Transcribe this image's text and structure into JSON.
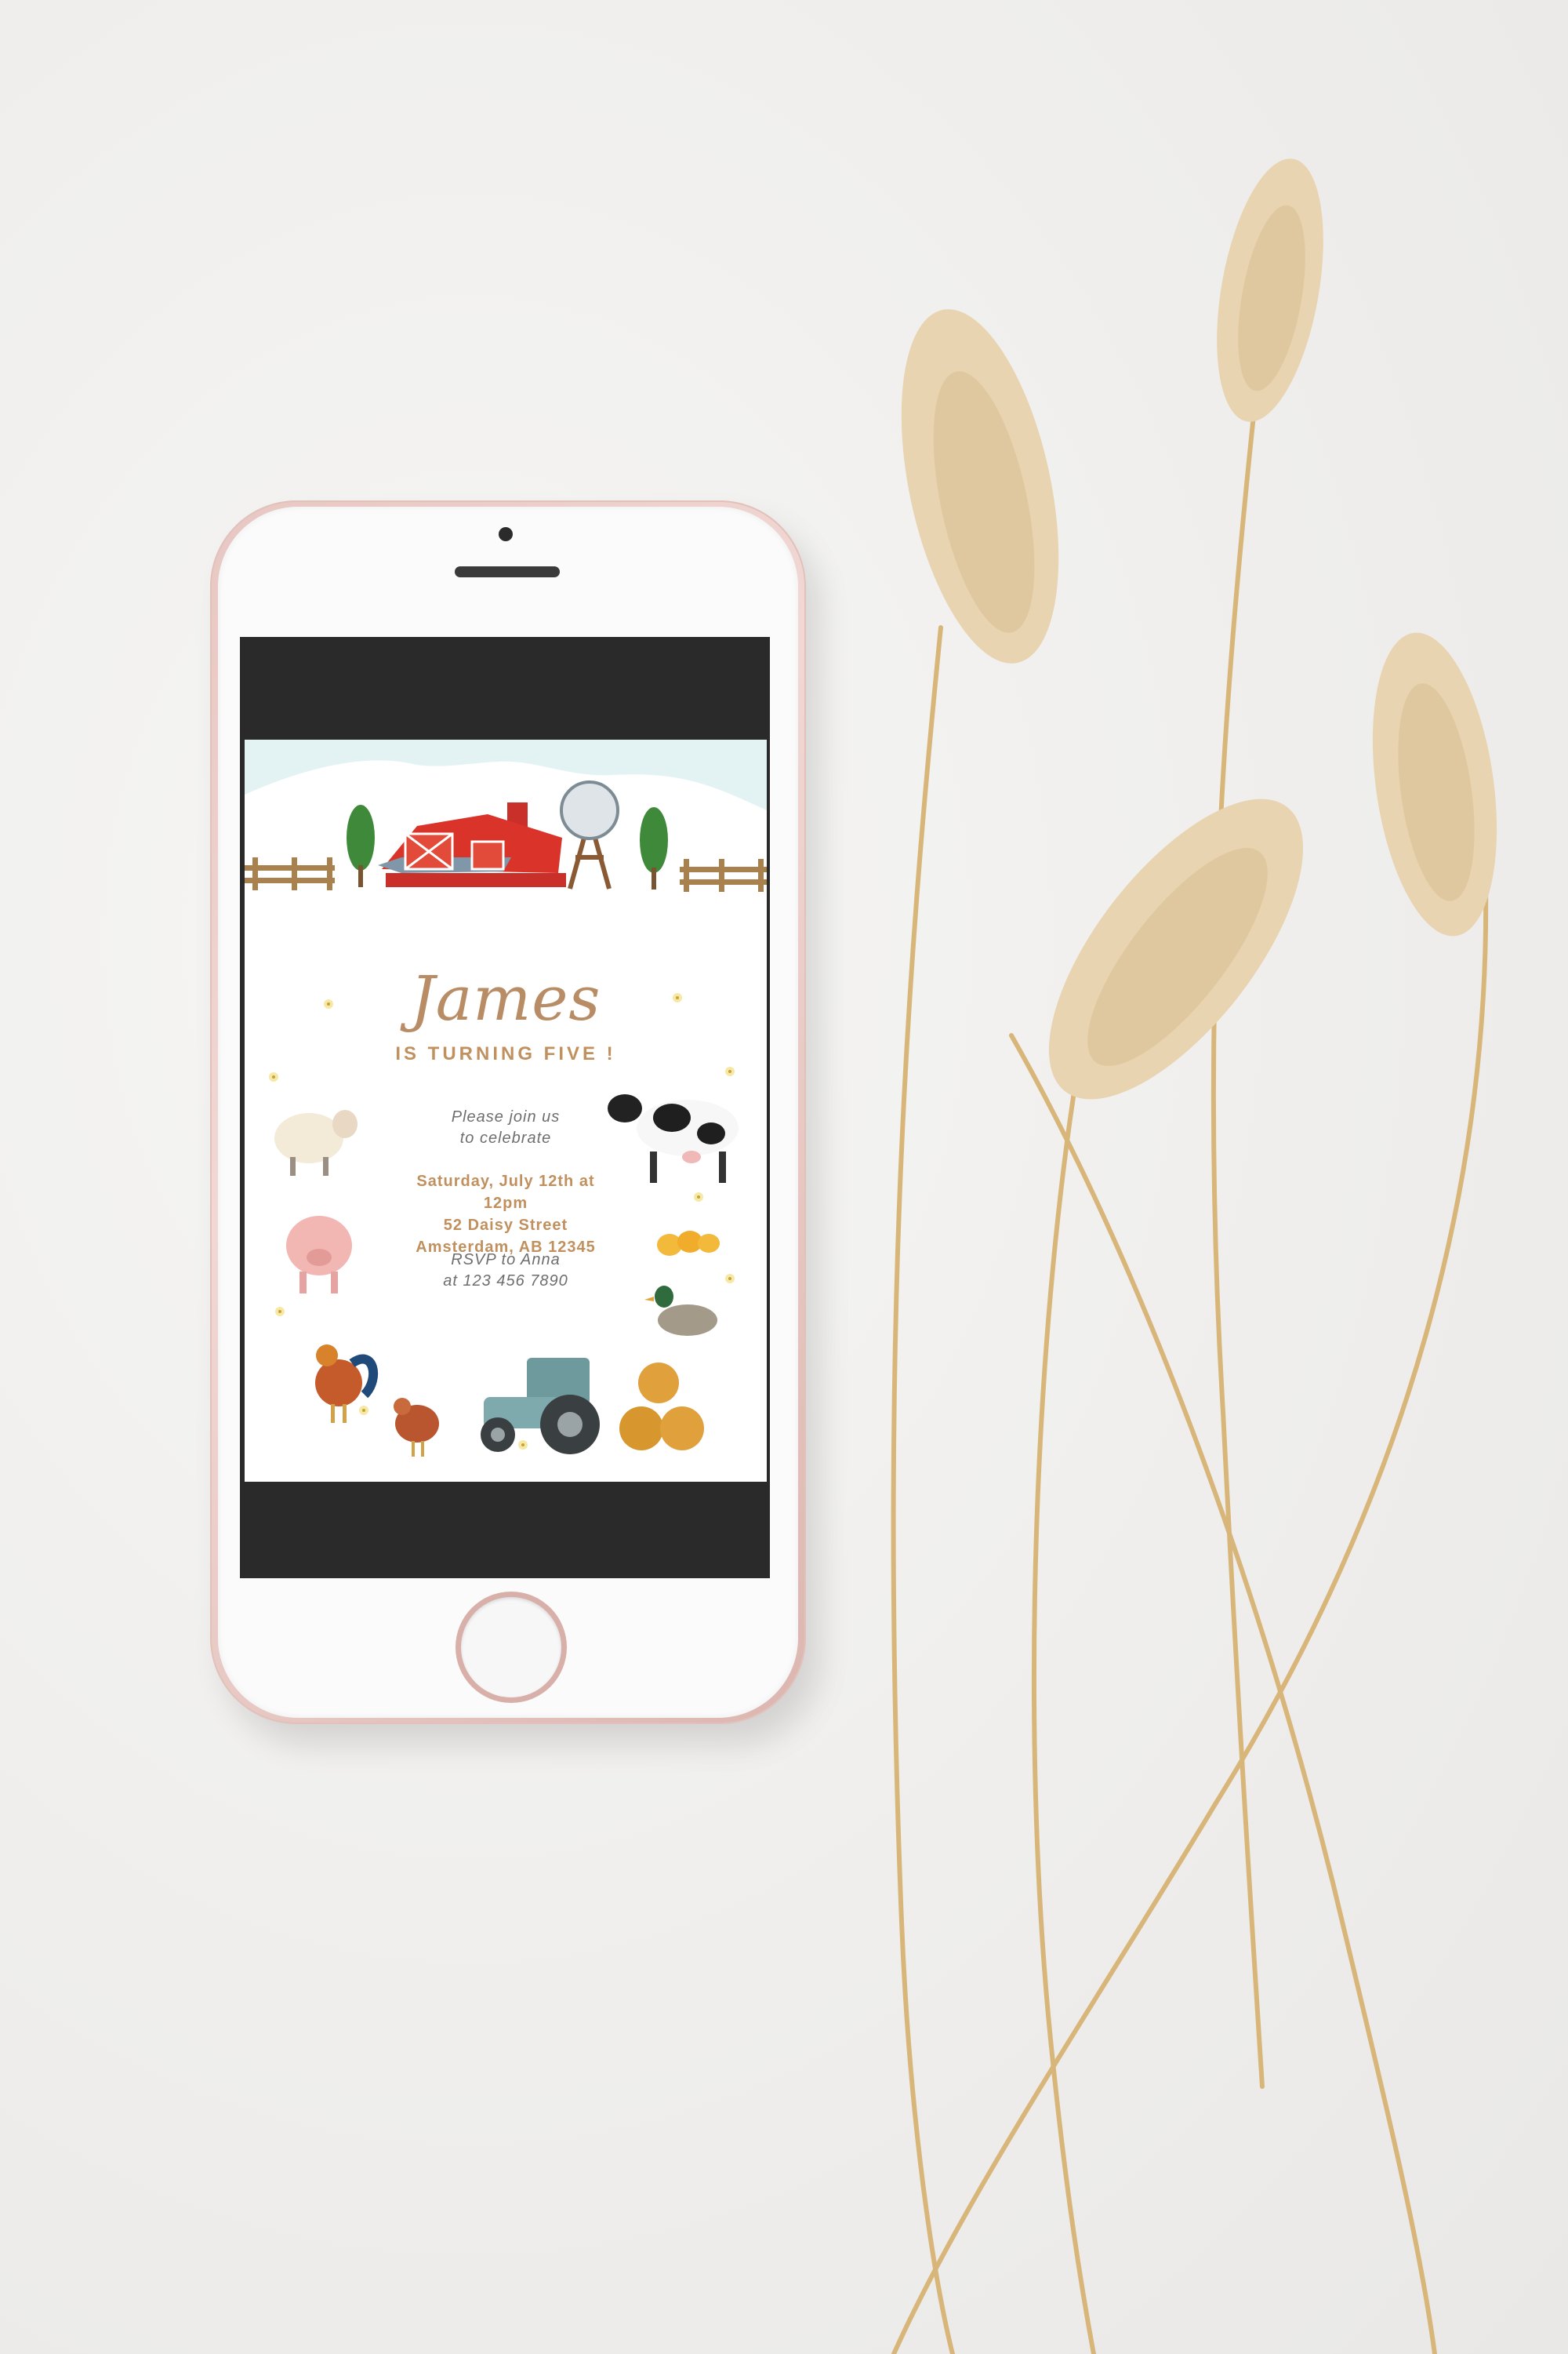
{
  "invitation": {
    "name": "James",
    "subtitle": "IS TURNING FIVE !",
    "invite_line_1": "Please join us",
    "invite_line_2": "to celebrate",
    "date_time": "Saturday, July 12th at 12pm",
    "street": "52 Daisy Street",
    "city": "Amsterdam, AB 12345",
    "rsvp_line_1": "RSVP to Anna",
    "rsvp_line_2": "at 123 456 7890"
  },
  "colors": {
    "background": "#efeeec",
    "phone_body": "#e9c9c4",
    "name_text": "#b88c64",
    "accent_text": "#c0905e",
    "barn_red": "#d9332a",
    "tractor_blue": "#6e9a9e",
    "grass_stem": "#d8b67a"
  },
  "icons": [
    "camera-icon",
    "speaker-icon",
    "home-button-icon",
    "barn-icon",
    "windmill-icon",
    "tree-icon",
    "fence-icon",
    "sheep-icon",
    "cow-icon",
    "pig-icon",
    "chicks-icon",
    "duck-icon",
    "rooster-icon",
    "hen-icon",
    "tractor-icon",
    "hay-bales-icon",
    "flower-icon",
    "bunny-tail-grass-icon"
  ]
}
